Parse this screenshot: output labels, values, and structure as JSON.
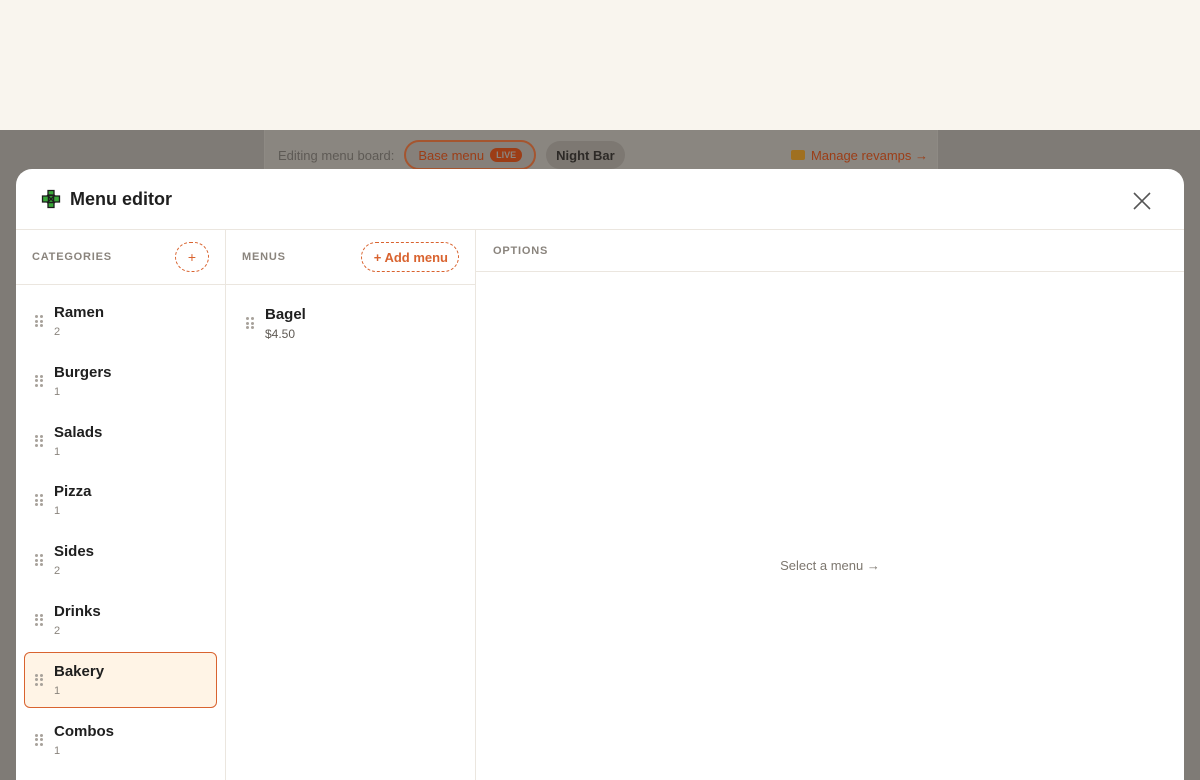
{
  "background": {
    "editing_label": "Editing menu board:",
    "active_board": "Base menu",
    "active_badge": "LIVE",
    "other_board": "Night Bar",
    "manage_link": "Manage revamps →"
  },
  "modal": {
    "title": "Menu editor",
    "icon": "puzzle-icon",
    "close_icon": "close-icon"
  },
  "categories": {
    "label": "CATEGORIES",
    "add_label": "+",
    "items": [
      {
        "name": "Ramen",
        "count": "2"
      },
      {
        "name": "Burgers",
        "count": "1"
      },
      {
        "name": "Salads",
        "count": "1"
      },
      {
        "name": "Pizza",
        "count": "1"
      },
      {
        "name": "Sides",
        "count": "2"
      },
      {
        "name": "Drinks",
        "count": "2"
      },
      {
        "name": "Bakery",
        "count": "1"
      },
      {
        "name": "Combos",
        "count": "1"
      }
    ],
    "selected": "Bakery"
  },
  "menus": {
    "label": "MENUS",
    "add_label": "+ Add menu",
    "items": [
      {
        "name": "Bagel",
        "price": "$4.50"
      }
    ]
  },
  "options": {
    "label": "OPTIONS",
    "placeholder": "Select a menu →"
  },
  "colors": {
    "accent": "#d9632f",
    "selected_bg": "#fff4e6",
    "overlay": "#7f7b76"
  }
}
